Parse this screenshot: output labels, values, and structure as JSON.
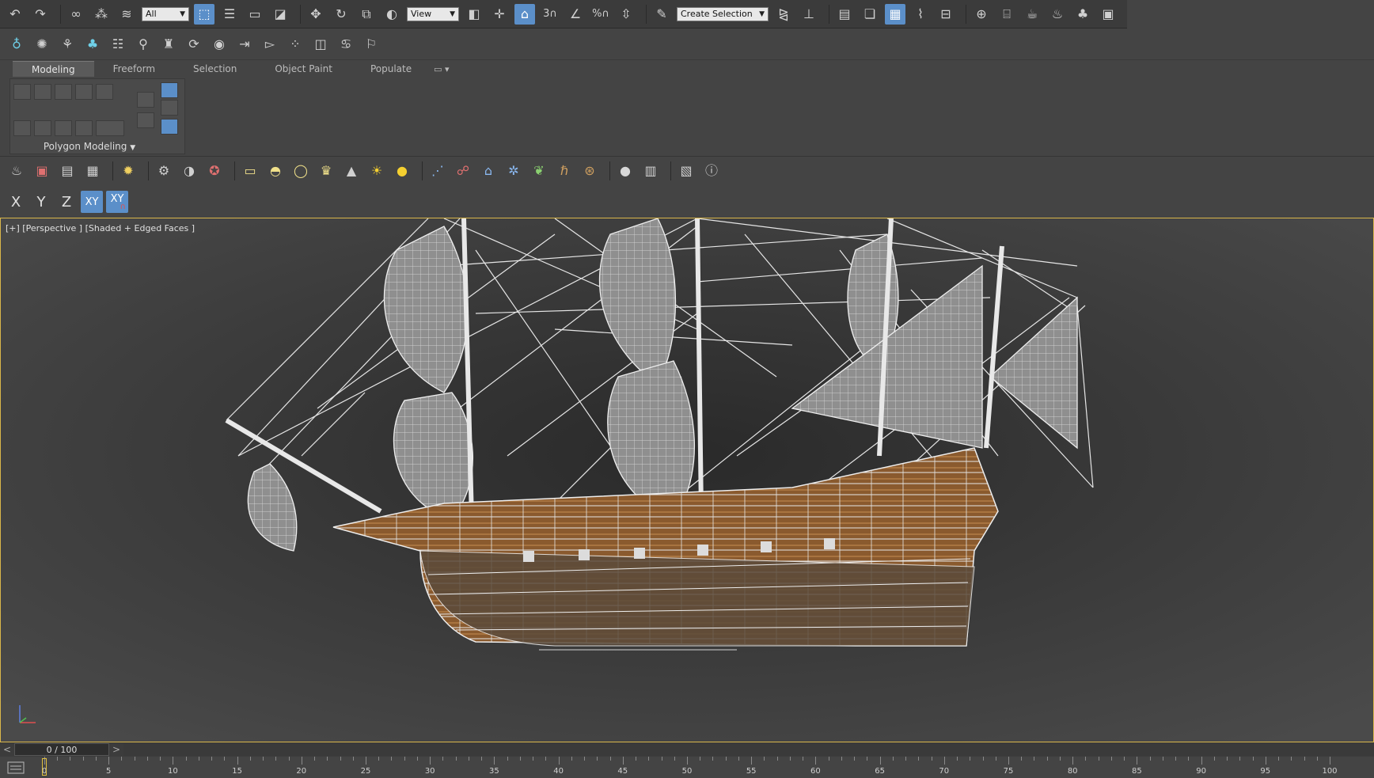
{
  "main_toolbar": {
    "selection_filter": "All",
    "reference_coord": "View",
    "snap_label": "3",
    "percent_snap": "%",
    "named_selection_placeholder": "Create Selection Se"
  },
  "ribbon": {
    "tabs": [
      {
        "label": "Modeling",
        "active": true
      },
      {
        "label": "Freeform",
        "active": false
      },
      {
        "label": "Selection",
        "active": false
      },
      {
        "label": "Object Paint",
        "active": false
      },
      {
        "label": "Populate",
        "active": false
      }
    ],
    "panel_label": "Polygon Modeling"
  },
  "axis_toolbar": {
    "x": "X",
    "y": "Y",
    "z": "Z",
    "xy": "XY",
    "xy_alt": "XY"
  },
  "viewport": {
    "label": "[+] [Perspective ] [Shaded + Edged Faces ]"
  },
  "time_slider": {
    "value": "0 / 100",
    "prev": "<",
    "next": ">"
  },
  "timeline": {
    "ticks": [
      "0",
      "5",
      "10",
      "15",
      "20",
      "25",
      "30",
      "35",
      "40",
      "45",
      "50",
      "55",
      "60",
      "65",
      "70",
      "75",
      "80",
      "85",
      "90",
      "95",
      "100"
    ]
  },
  "colors": {
    "accent": "#5b8fc9",
    "viewport_border": "#d9b64a",
    "wire": "#e6e6e6",
    "hull": "#8a5a2e"
  }
}
